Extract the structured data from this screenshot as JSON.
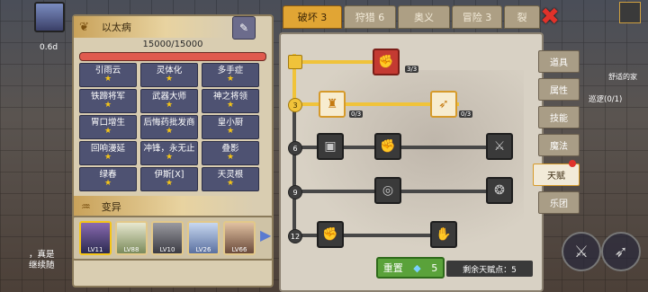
{
  "character": {
    "name": "以太病",
    "hp": "15000/15000",
    "hp_fraction": 1.0
  },
  "traits": [
    {
      "label": "引雨云"
    },
    {
      "label": "灵体化"
    },
    {
      "label": "多手症"
    },
    {
      "label": "铁蹄将军"
    },
    {
      "label": "武器大师"
    },
    {
      "label": "神之将领"
    },
    {
      "label": "胃口增生"
    },
    {
      "label": "后悔药批发商"
    },
    {
      "label": "皇小厨"
    },
    {
      "label": "回响漫延"
    },
    {
      "label": "冲锋，永无止"
    },
    {
      "label": "叠影"
    },
    {
      "label": "绿春"
    },
    {
      "label": "伊斯[X]"
    },
    {
      "label": "天灵根"
    }
  ],
  "mutation": {
    "title": "变异",
    "avatars": [
      {
        "level": "LV11"
      },
      {
        "label": "LV88"
      },
      {
        "level": "LV10"
      },
      {
        "level": "LV26"
      },
      {
        "level": "LV66"
      }
    ]
  },
  "tabs": [
    {
      "label": "破坏 3",
      "active": true
    },
    {
      "label": "狩猎 6"
    },
    {
      "label": "奥义"
    },
    {
      "label": "冒险 3"
    },
    {
      "label": "裂"
    }
  ],
  "side_tabs": [
    {
      "label": "道具"
    },
    {
      "label": "属性"
    },
    {
      "label": "技能"
    },
    {
      "label": "魔法"
    },
    {
      "label": "天赋",
      "active": true
    },
    {
      "label": "乐团"
    }
  ],
  "talent_tree": {
    "levels": [
      "3",
      "6",
      "9",
      "12"
    ],
    "top_count": "3/3",
    "row3_left_count": "0/3",
    "row3_right_count": "0/3"
  },
  "footer": {
    "reset_label": "重置",
    "gem_cost": "5",
    "remaining_label": "剩余天赋点：5"
  },
  "scene_text": {
    "left_line1": "，真是",
    "left_line2": "继续随",
    "right_top": "舒适的家",
    "right_mid": "巡逻(0/1)",
    "left_top": "0.6d"
  },
  "colors": {
    "tab_active": "#e1a534",
    "panel_bg": "#d8d1c4",
    "hp_bar": "#e05a4e"
  }
}
